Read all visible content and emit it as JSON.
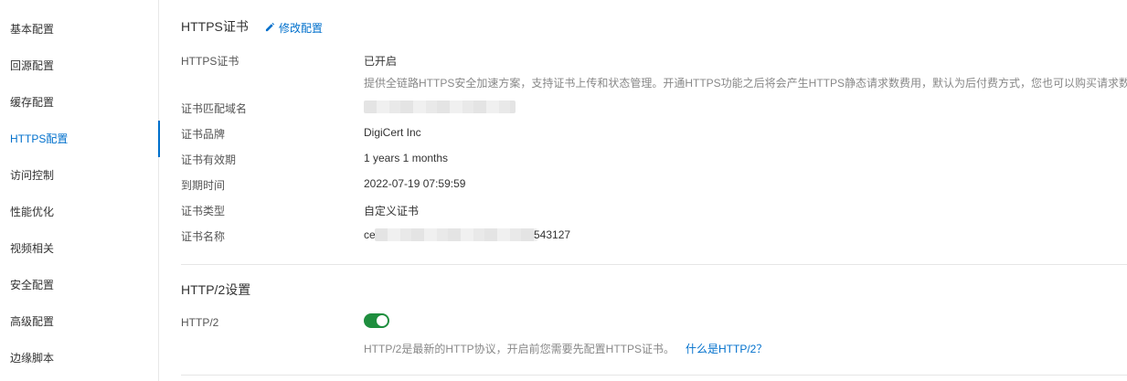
{
  "sidebar": {
    "items": [
      {
        "label": "基本配置"
      },
      {
        "label": "回源配置"
      },
      {
        "label": "缓存配置"
      },
      {
        "label": "HTTPS配置",
        "active": true
      },
      {
        "label": "访问控制"
      },
      {
        "label": "性能优化"
      },
      {
        "label": "视频相关"
      },
      {
        "label": "安全配置"
      },
      {
        "label": "高级配置"
      },
      {
        "label": "边缘脚本"
      }
    ]
  },
  "https_section": {
    "title": "HTTPS证书",
    "edit_label": "修改配置",
    "rows": {
      "cert": {
        "label": "HTTPS证书",
        "value": "已开启",
        "desc": "提供全链路HTTPS安全加速方案，支持证书上传和状态管理。开通HTTPS功能之后将会产生HTTPS静态请求数费用，默认为后付费方式，您也可以购买请求数资"
      },
      "domain": {
        "label": "证书匹配域名"
      },
      "brand": {
        "label": "证书品牌",
        "value": "DigiCert Inc"
      },
      "validity": {
        "label": "证书有效期",
        "value": "1 years 1 months"
      },
      "expiry": {
        "label": "到期时间",
        "value": "2022-07-19 07:59:59"
      },
      "type": {
        "label": "证书类型",
        "value": "自定义证书"
      },
      "name": {
        "label": "证书名称",
        "value_prefix": "ce",
        "value_suffix": "543127"
      }
    }
  },
  "http2_section": {
    "title": "HTTP/2设置",
    "label": "HTTP/2",
    "enabled": true,
    "desc": "HTTP/2是最新的HTTP协议，开启前您需要先配置HTTPS证书。",
    "help_link": "什么是HTTP/2？"
  },
  "colors": {
    "accent": "#0070cc",
    "toggle_on": "#1e8e3e"
  }
}
